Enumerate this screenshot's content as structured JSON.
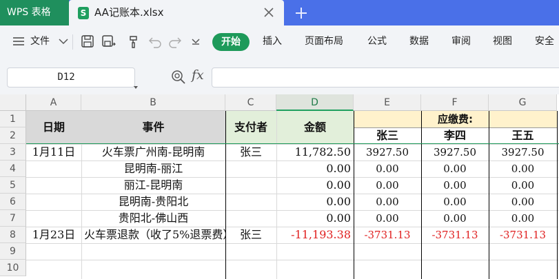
{
  "tabs": {
    "app_label": "WPS 表格",
    "file_icon_letter": "S",
    "file_name": "AA记账本.xlsx"
  },
  "ribbon": {
    "menu_label": "文件",
    "items": [
      "开始",
      "插入",
      "页面布局",
      "公式",
      "数据",
      "审阅",
      "视图",
      "安全"
    ]
  },
  "formula_bar": {
    "cell_ref": "D12",
    "fx": "fx",
    "formula": ""
  },
  "sheet": {
    "columns": [
      "A",
      "B",
      "C",
      "D",
      "E",
      "F",
      "G"
    ],
    "active_column": "D",
    "rows": [
      "1",
      "2",
      "3",
      "4",
      "5",
      "6",
      "7",
      "8",
      "9",
      "10"
    ],
    "headers": {
      "date": "日期",
      "event": "事件",
      "payer": "支付者",
      "amount": "金额",
      "due": "应缴费:",
      "persons": [
        "张三",
        "李四",
        "王五"
      ]
    },
    "data_rows": [
      {
        "date": "1月11日",
        "event": "火车票广州南-昆明南",
        "payer": "张三",
        "amount": "11,782.50",
        "shares": [
          "3927.50",
          "3927.50",
          "3927.50"
        ]
      },
      {
        "date": "",
        "event": "昆明南-丽江",
        "payer": "",
        "amount": "0.00",
        "shares": [
          "0.00",
          "0.00",
          "0.00"
        ]
      },
      {
        "date": "",
        "event": "丽江-昆明南",
        "payer": "",
        "amount": "0.00",
        "shares": [
          "0.00",
          "0.00",
          "0.00"
        ]
      },
      {
        "date": "",
        "event": "昆明南-贵阳北",
        "payer": "",
        "amount": "0.00",
        "shares": [
          "0.00",
          "0.00",
          "0.00"
        ]
      },
      {
        "date": "",
        "event": "贵阳北-佛山西",
        "payer": "",
        "amount": "0.00",
        "shares": [
          "0.00",
          "0.00",
          "0.00"
        ]
      },
      {
        "date": "1月23日",
        "event": "火车票退款（收了5%退票费）",
        "payer": "张三",
        "amount": "-11,193.38",
        "shares": [
          "-3731.13",
          "-3731.13",
          "-3731.13"
        ]
      }
    ]
  },
  "colors": {
    "app_tab": "#1f8f5d",
    "tabbar": "#4a70e8",
    "accent_green": "#1e9a5a",
    "header_gray": "#d9d9d9",
    "header_green": "#e2efda",
    "header_yellow": "#fff2cc",
    "negative_red": "#e02020"
  }
}
